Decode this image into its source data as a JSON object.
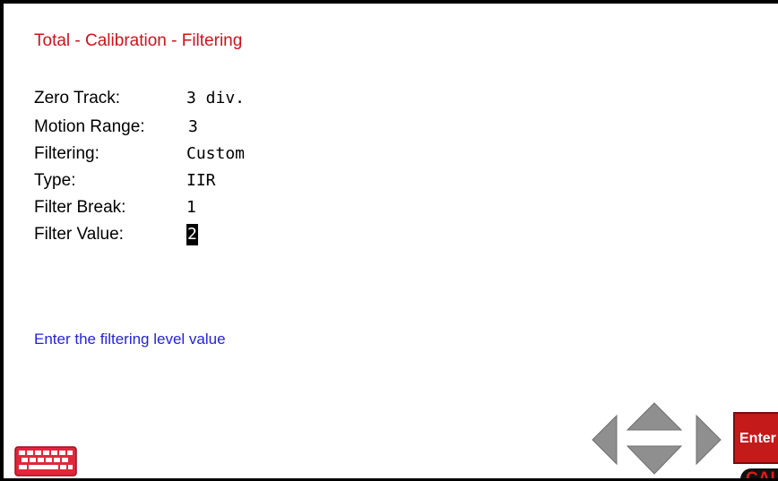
{
  "screen": {
    "title": "Total - Calibration - Filtering",
    "hint": "Enter the filtering level value"
  },
  "fields": [
    {
      "label": "Zero Track:",
      "value": "3 div."
    },
    {
      "label": "Motion Range:",
      "value": "3"
    },
    {
      "label": "Filtering:",
      "value": "Custom"
    },
    {
      "label": "Type:",
      "value": "IIR"
    },
    {
      "label": "Filter Break:",
      "value": "1"
    },
    {
      "label": "Filter Value:",
      "value": "2"
    }
  ],
  "controls": {
    "enter_label": "Enter",
    "cal_label": "CAL",
    "keyboard_icon": "keyboard-icon",
    "nav_icons": [
      "arrow-left-icon",
      "arrow-up-icon",
      "arrow-down-icon",
      "arrow-right-icon"
    ]
  },
  "colors": {
    "title": "#d0121b",
    "hint": "#2323e0",
    "enter_button": "#c41a1a",
    "keyboard_icon": "#e0283a",
    "nav_arrows": "#8f8f8f",
    "cal_text": "#e01a1a"
  }
}
